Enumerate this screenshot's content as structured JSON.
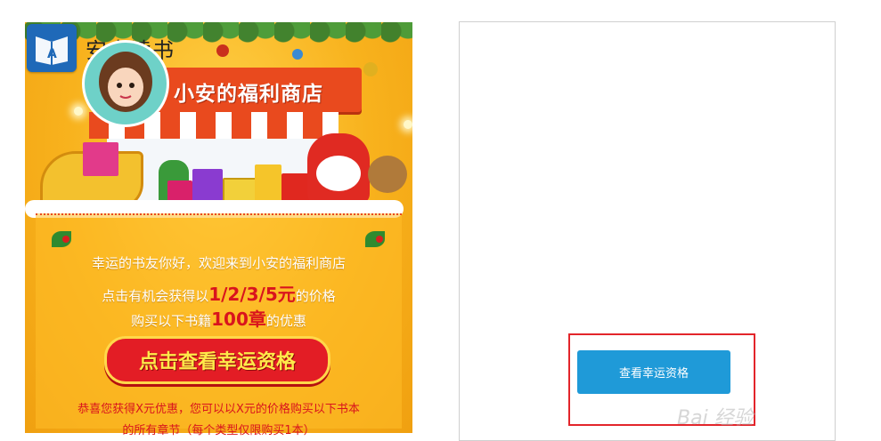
{
  "app": {
    "name": "安卓读书",
    "logo_icon": "book-logo-icon",
    "brand_color": "#1f69b8"
  },
  "promo": {
    "banner_title": "小安的福利商店",
    "greeting": "幸运的书友你好，欢迎来到小安的福利商店",
    "offer_prefix": "点击有机会获得以",
    "offer_prices": "1/2/3/5元",
    "offer_suffix": "的价格",
    "books_prefix": "购买以下书籍",
    "books_chapters": "100章",
    "books_suffix": "的优惠",
    "cta_label": "点击查看幸运资格",
    "congrats_line1": "恭喜您获得X元优惠，您可以以X元的价格购买以下书本",
    "congrats_line2": "的所有章节（每个类型仅限购买1本）",
    "colors": {
      "accent_red": "#e31d25",
      "highlight_text": "#d9141d",
      "background": "#f8b21d"
    }
  },
  "right_panel": {
    "check_button_label": "查看幸运资格",
    "button_color": "#1f9ad8",
    "highlight_border_color": "#e3252b",
    "watermark_text": "Bai 经验"
  }
}
